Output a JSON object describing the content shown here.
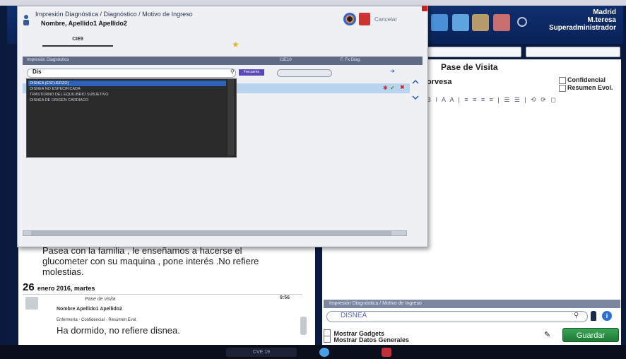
{
  "app": {
    "user": {
      "location": "Madrid",
      "name": "M.teresa",
      "role": "Superadministrador"
    }
  },
  "dialog": {
    "title": "Impresión Diagnóstica / Diagnóstico / Motivo de Ingreso",
    "subtitle": "Nombre, Apellido1 Apellido2",
    "cancel_label": "Cancelar",
    "tab_label": "CIE9",
    "grid_headers": {
      "diagnosis": "Impresión Diagnóstica",
      "cie": "CIE10",
      "fx_diag": "F. Fx Diag."
    },
    "filter_value": "Dis",
    "filter_badge": "Frecuente",
    "dropdown_items": [
      "DISNEA (ESFUERZO)",
      "DISNEA NO ESPECIFICADA",
      "TRASTORNO DEL EQUILIBRIO SUBJETIVO",
      "DISNEA DE ORIGEN CARDIACO"
    ]
  },
  "right": {
    "pase_title": "Pase de Visita",
    "partial_text": "orvesa",
    "confidencial_label": "Confidencial",
    "resumen_label": "Resumen Evol.",
    "editor_toolbar": "B  I  A  A  |  ≡  ≡  ≡  ≡  |  ☰  ☰  |  ⟲  ⟳  ◻",
    "diag_header": "Impresión Diagnóstica / Motivo de Ingreso",
    "diag_input_value": "DISNEA",
    "mostrar_gadgets": "Mostrar Gadgets",
    "mostrar_datos": "Mostrar Datos Generales",
    "guardar_label": "Guardar"
  },
  "left": {
    "history_text": "Pasea con la familia , le enseñamos a hacerse el glucometer con su maquina , pone interés .No refiere molestias.",
    "date_day": "26",
    "date_rest": "enero 2016, martes",
    "entry_time": "9:56",
    "entry_subtitle": "Pase de visita",
    "entry_author": "Nombre Apellido1 Apellido2",
    "entry_meta": "Enfermería · Confidencial · Resumen Evol.",
    "entry_text": "Ha dormido, no refiere disnea."
  },
  "taskbar": {
    "label": "CVE 19"
  },
  "colors": {
    "accent": "#2c63b8",
    "save": "#2f8f47",
    "header": "#5f6b85"
  }
}
